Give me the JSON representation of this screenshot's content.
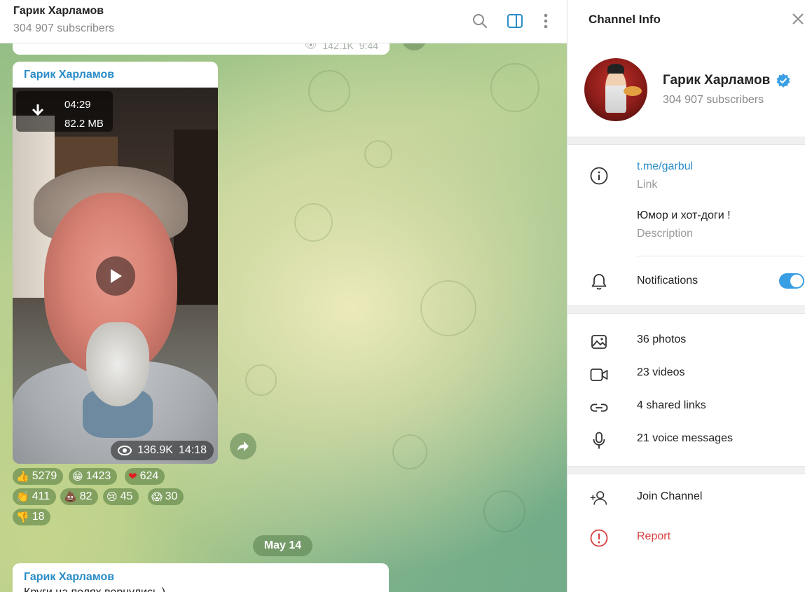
{
  "chat": {
    "title": "Гарик Харламов",
    "subtitle": "304 907 subscribers",
    "prev_message": {
      "views": "142.1K",
      "time": "9:44"
    },
    "message": {
      "author": "Гарик Харламов",
      "video": {
        "duration": "04:29",
        "size": "82.2 MB",
        "views": "136.9K",
        "time": "14:18"
      },
      "reactions": [
        {
          "emoji": "👍",
          "count": "5279"
        },
        {
          "emoji": "😁",
          "count": "1423"
        },
        {
          "emoji": "❤",
          "count": "624"
        },
        {
          "emoji": "👏",
          "count": "411"
        },
        {
          "emoji": "💩",
          "count": "82"
        },
        {
          "emoji": "😢",
          "count": "45"
        },
        {
          "emoji": "😱",
          "count": "30"
        },
        {
          "emoji": "👎",
          "count": "18"
        }
      ]
    },
    "date_separator": "May 14",
    "next_message": {
      "author": "Гарик Харламов",
      "text": "Круги на полях вернулись )"
    }
  },
  "panel": {
    "title": "Channel Info",
    "channel_name": "Гарик Харламов",
    "subscribers": "304 907 subscribers",
    "link": {
      "value": "t.me/garbul",
      "label": "Link"
    },
    "description": {
      "value": "Юмор и хот-доги !",
      "label": "Description"
    },
    "notifications_label": "Notifications",
    "notifications_on": true,
    "media": {
      "photos": "36 photos",
      "videos": "23 videos",
      "links": "4 shared links",
      "voice": "21 voice messages"
    },
    "join_label": "Join Channel",
    "report_label": "Report"
  },
  "colors": {
    "accent": "#2a8cc8",
    "toggle": "#3a9ee4",
    "danger": "#d94040"
  }
}
